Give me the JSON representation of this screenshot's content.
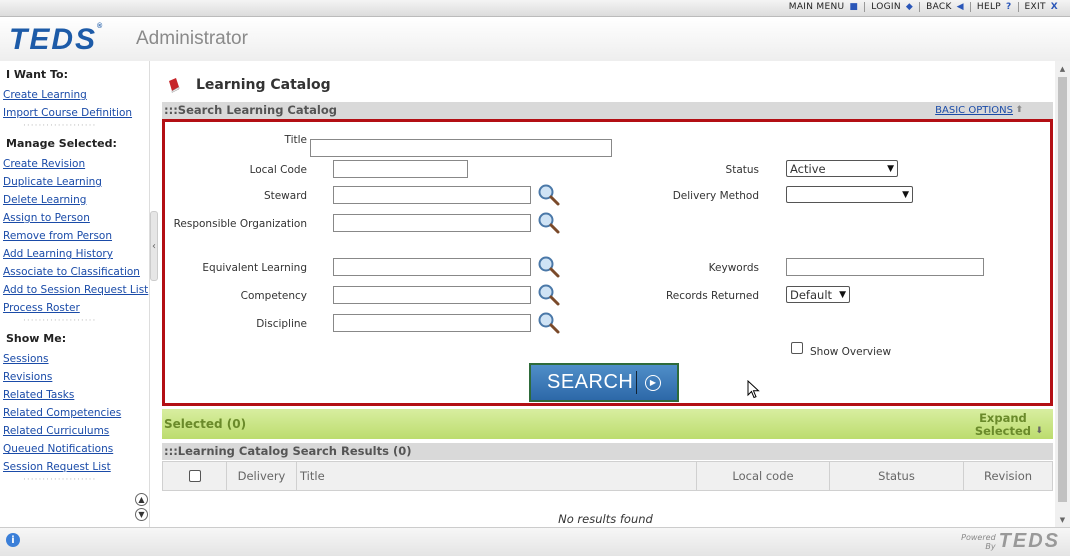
{
  "topnav": {
    "items": [
      {
        "label": "MAIN MENU",
        "icon": "■"
      },
      {
        "label": "LOGIN",
        "icon": "◆"
      },
      {
        "label": "BACK",
        "icon": "◀"
      },
      {
        "label": "HELP",
        "icon": "?"
      },
      {
        "label": "EXIT",
        "icon": "X"
      }
    ]
  },
  "header": {
    "logo": "TEDS",
    "app_title": "Administrator"
  },
  "sidebar": {
    "i_want_to": {
      "heading": "I Want To:",
      "links": [
        "Create Learning",
        "Import Course Definition"
      ]
    },
    "manage_selected": {
      "heading": "Manage Selected:",
      "links": [
        "Create Revision",
        "Duplicate Learning",
        "Delete Learning",
        "Assign to Person",
        "Remove from Person",
        "Add Learning History",
        "Associate to Classification",
        "Add to Session Request List",
        "Process Roster"
      ]
    },
    "show_me": {
      "heading": "Show Me:",
      "links": [
        "Sessions",
        "Revisions",
        "Related Tasks",
        "Related Competencies",
        "Related Curriculums",
        "Queued Notifications",
        "Session Request List"
      ]
    },
    "dots": "···················"
  },
  "main": {
    "title": "Learning Catalog",
    "search_panel": {
      "header": ":::Search Learning Catalog",
      "basic_options": "BASIC OPTIONS",
      "fields": {
        "title": {
          "label": "Title",
          "value": ""
        },
        "local_code": {
          "label": "Local Code",
          "value": ""
        },
        "steward": {
          "label": "Steward",
          "value": ""
        },
        "responsible_org": {
          "label": "Responsible Organization",
          "value": ""
        },
        "equivalent_learning": {
          "label": "Equivalent Learning",
          "value": ""
        },
        "competency": {
          "label": "Competency",
          "value": ""
        },
        "discipline": {
          "label": "Discipline",
          "value": ""
        },
        "status": {
          "label": "Status",
          "value": "Active"
        },
        "delivery_method": {
          "label": "Delivery Method",
          "value": ""
        },
        "keywords": {
          "label": "Keywords",
          "value": ""
        },
        "records_returned": {
          "label": "Records Returned",
          "value": "Default"
        },
        "show_overview": {
          "label": "Show Overview",
          "checked": false
        }
      },
      "search_button": "SEARCH"
    },
    "selected": {
      "label": "Selected (0)",
      "expand_line1": "Expand",
      "expand_line2": "Selected"
    },
    "results": {
      "header": ":::Learning Catalog Search Results (0)",
      "columns": [
        "Delivery",
        "Title",
        "Local code",
        "Status",
        "Revision"
      ],
      "empty_text": "No results found"
    }
  },
  "footer": {
    "powered_line1": "Powered",
    "powered_line2": "By",
    "logo": "TEDS"
  },
  "colors": {
    "accent_red": "#b30f14",
    "link_blue": "#1a4ba8",
    "selected_green": "#bcdc6e",
    "search_blue": "#2d68a8"
  }
}
